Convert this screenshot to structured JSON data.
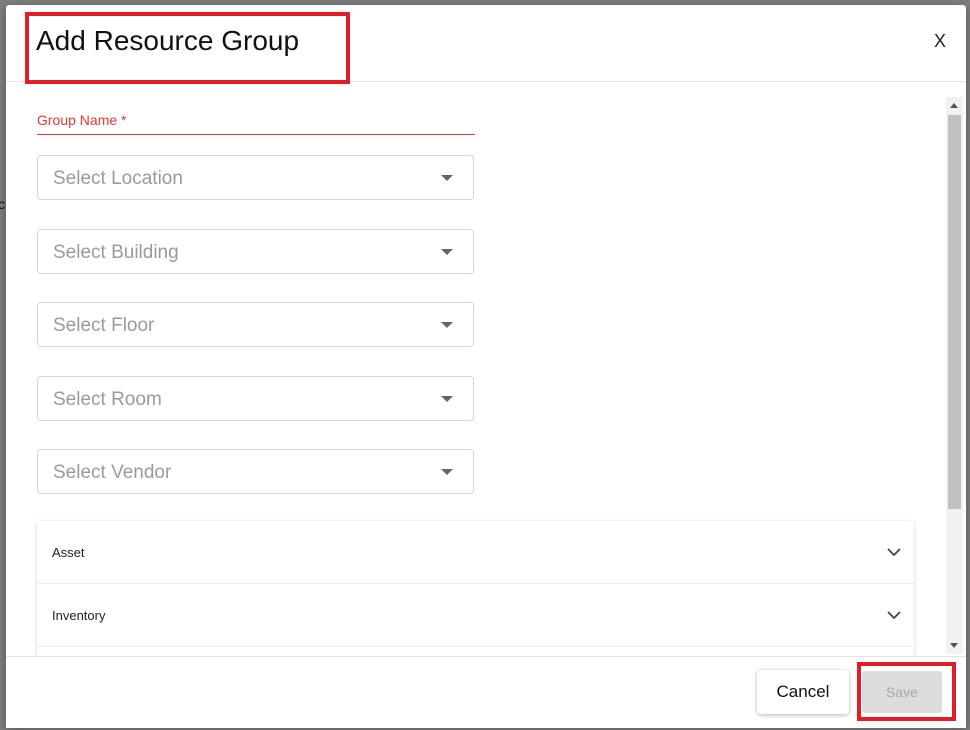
{
  "modal": {
    "title": "Add Resource Group",
    "close_label": "X"
  },
  "form": {
    "group_name_label": "Group Name *",
    "selects": [
      {
        "placeholder": "Select Location"
      },
      {
        "placeholder": "Select Building"
      },
      {
        "placeholder": "Select Floor"
      },
      {
        "placeholder": "Select Room"
      },
      {
        "placeholder": "Select Vendor"
      }
    ],
    "accordion": [
      {
        "label": "Asset"
      },
      {
        "label": "Inventory"
      }
    ]
  },
  "footer": {
    "cancel_label": "Cancel",
    "save_label": "Save"
  },
  "colors": {
    "accent_error": "#e53935",
    "annotation": "#e11d2a"
  }
}
